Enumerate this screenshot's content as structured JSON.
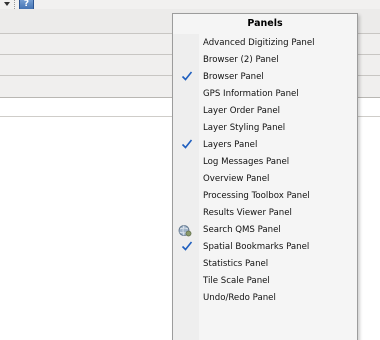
{
  "menu": {
    "title": "Panels",
    "items": [
      {
        "label": "Advanced Digitizing Panel",
        "checked": false
      },
      {
        "label": "Browser (2) Panel",
        "checked": false
      },
      {
        "label": "Browser Panel",
        "checked": true
      },
      {
        "label": "GPS Information Panel",
        "checked": false
      },
      {
        "label": "Layer Order Panel",
        "checked": false
      },
      {
        "label": "Layer Styling Panel",
        "checked": false
      },
      {
        "label": "Layers Panel",
        "checked": true
      },
      {
        "label": "Log Messages Panel",
        "checked": false
      },
      {
        "label": "Overview Panel",
        "checked": false
      },
      {
        "label": "Processing Toolbox Panel",
        "checked": false
      },
      {
        "label": "Results Viewer Panel",
        "checked": false
      },
      {
        "label": "Search QMS Panel",
        "checked": false,
        "icon": "qms-globe-icon"
      },
      {
        "label": "Spatial Bookmarks Panel",
        "checked": true
      },
      {
        "label": "Statistics Panel",
        "checked": false
      },
      {
        "label": "Tile Scale Panel",
        "checked": false
      },
      {
        "label": "Undo/Redo Panel",
        "checked": false
      }
    ]
  },
  "toolbar": {
    "help_icon_glyph": "?"
  },
  "colors": {
    "check": "#1f5fbf",
    "menu_bg": "#f5f5f5"
  }
}
